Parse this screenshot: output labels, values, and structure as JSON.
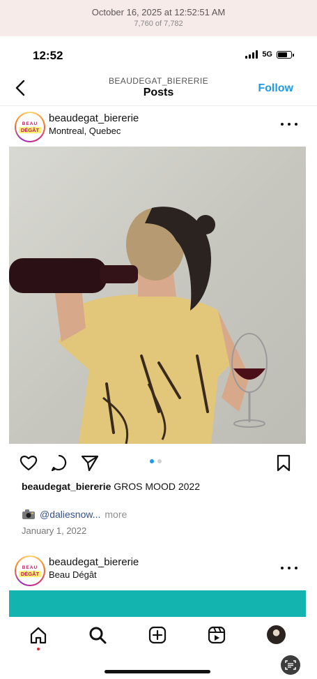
{
  "banner": {
    "date": "October 16, 2025 at 12:52:51 AM",
    "count": "7,760 of 7,782"
  },
  "status_bar": {
    "time": "12:52",
    "network": "5G",
    "icons": [
      "signal-icon",
      "battery-icon"
    ]
  },
  "header": {
    "account": "BEAUDEGAT_BIERERIE",
    "title": "Posts",
    "follow_label": "Follow",
    "follow_color": "#1a9bf0"
  },
  "posts": [
    {
      "avatar_line1": "BEAU",
      "avatar_line2": "DÉGÂT",
      "username": "beaudegat_biererie",
      "location": "Montreal, Quebec",
      "caption_user": "beaudegat_biererie",
      "caption_text": "GROS MOOD 2022",
      "camera_emoji": "📸",
      "mention": "@daliesnow...",
      "more_label": "more",
      "date": "January 1, 2022",
      "carousel_index": 1,
      "carousel_count": 2
    },
    {
      "avatar_line1": "BEAU",
      "avatar_line2": "DÉGÂT",
      "username": "beaudegat_biererie",
      "location": "Beau Dégât"
    }
  ],
  "bottom_nav": {
    "tabs": [
      "home-icon",
      "search-icon",
      "create-icon",
      "reels-icon",
      "profile-avatar"
    ],
    "active": "home-icon",
    "indicator_color": "#e5202c"
  },
  "colors": {
    "banner_bg": "#f6ebe8",
    "accent": "#1a9bf0",
    "teal": "#13b3b0"
  }
}
